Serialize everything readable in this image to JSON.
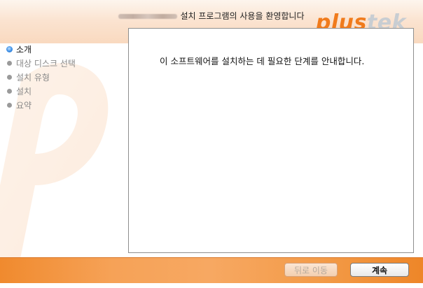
{
  "window": {
    "title": "설치 프로그램의 사용을 환영합니다"
  },
  "logo": {
    "part1": "plus",
    "part2": "tek",
    "color_primary": "#f07b1c",
    "color_secondary": "#c8cdd2"
  },
  "sidebar": {
    "steps": [
      {
        "label": "소개",
        "state": "active"
      },
      {
        "label": "대상 디스크 선택",
        "state": "pending"
      },
      {
        "label": "설치 유형",
        "state": "pending"
      },
      {
        "label": "설치",
        "state": "pending"
      },
      {
        "label": "요약",
        "state": "pending"
      }
    ]
  },
  "content": {
    "text": "이 소프트웨어를 설치하는 데 필요한 단계를 안내합니다."
  },
  "buttons": {
    "back_label": "뒤로 이동",
    "continue_label": "계속"
  },
  "colors": {
    "accent": "#f39b48",
    "header_tint": "#f9d9bf"
  }
}
